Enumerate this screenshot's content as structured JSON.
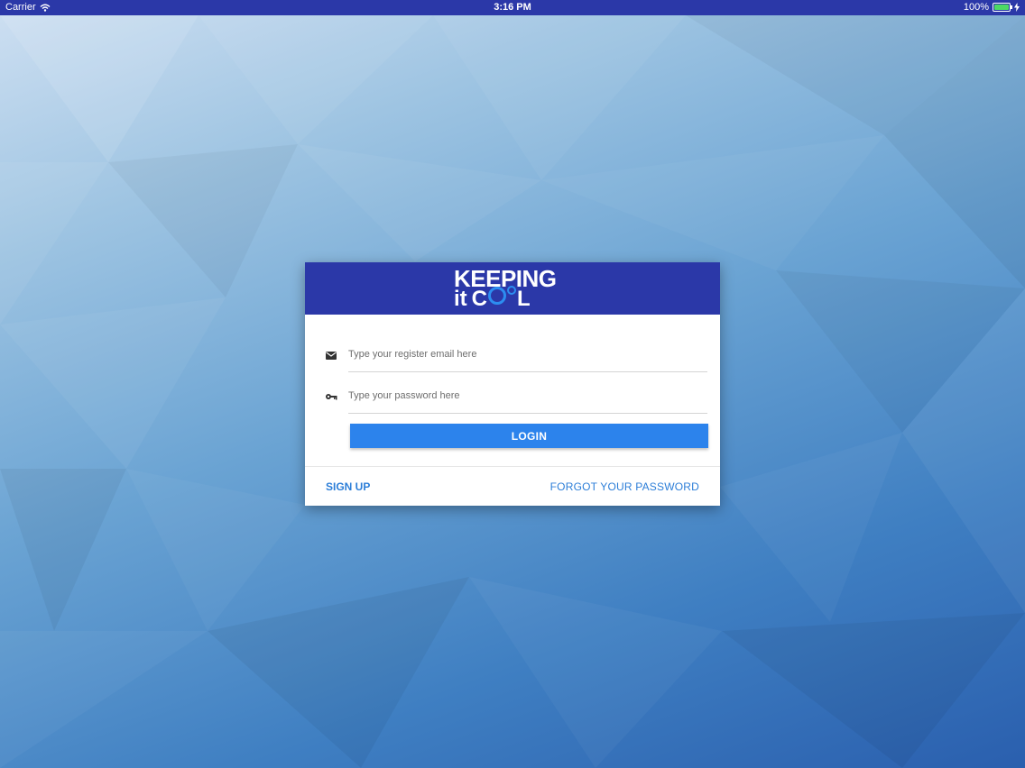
{
  "status_bar": {
    "carrier": "Carrier",
    "time": "3:16 PM",
    "battery": "100%",
    "icons": {
      "wifi": "wifi-icon",
      "battery": "battery-icon",
      "charging": "charging-icon"
    }
  },
  "login_card": {
    "logo": {
      "line1": "KEEPING",
      "line2_prefix": "it",
      "line2_c": "C",
      "line2_suffix": "L"
    },
    "email": {
      "placeholder": "Type your register email here",
      "value": "",
      "icon": "envelope-icon"
    },
    "password": {
      "placeholder": "Type your password here",
      "value": "",
      "icon": "key-icon"
    },
    "login_label": "LOGIN",
    "signup_label": "SIGN UP",
    "forgot_label": "FORGOT YOUR PASSWORD"
  },
  "colors": {
    "brand": "#2b38a8",
    "accent": "#2c83ec",
    "link": "#2c7ed8"
  }
}
